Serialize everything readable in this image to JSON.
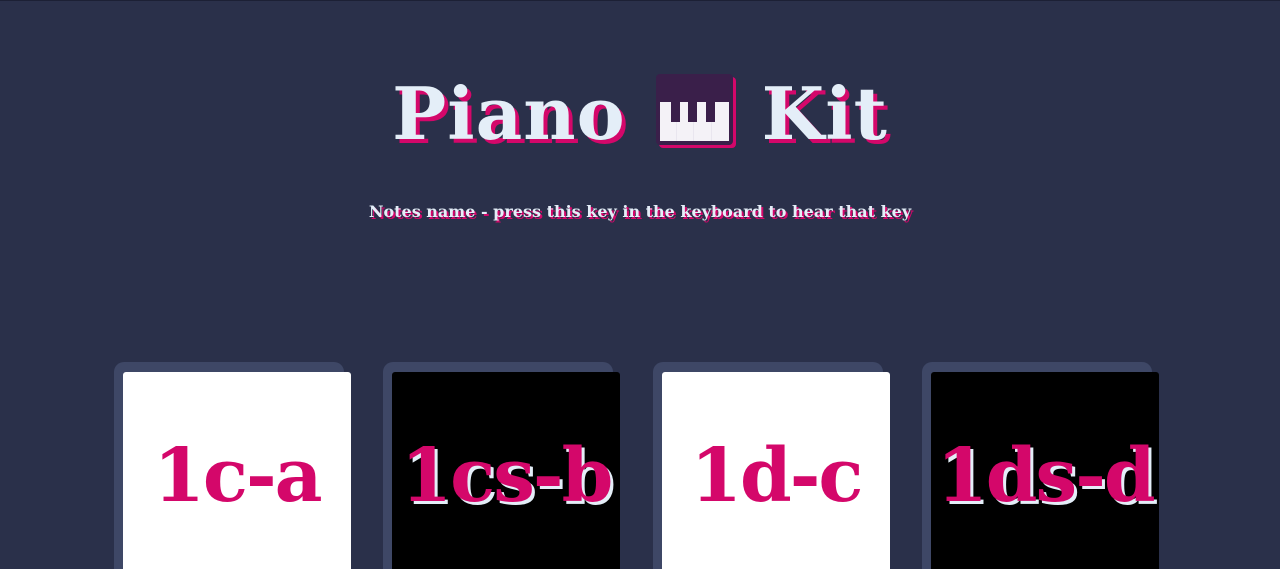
{
  "header": {
    "title_left": "Piano",
    "title_icon": "piano-keyboard-icon",
    "title_right": "Kit",
    "subtitle": "Notes name - press this key in the keyboard to hear that key"
  },
  "colors": {
    "background": "#2a304a",
    "frame": "#3e4766",
    "accent": "#d4076a",
    "text": "#e4eef8"
  },
  "keys": [
    {
      "label": "1c-a",
      "color": "white"
    },
    {
      "label": "1cs-b",
      "color": "black"
    },
    {
      "label": "1d-c",
      "color": "white"
    },
    {
      "label": "1ds-d",
      "color": "black"
    }
  ]
}
